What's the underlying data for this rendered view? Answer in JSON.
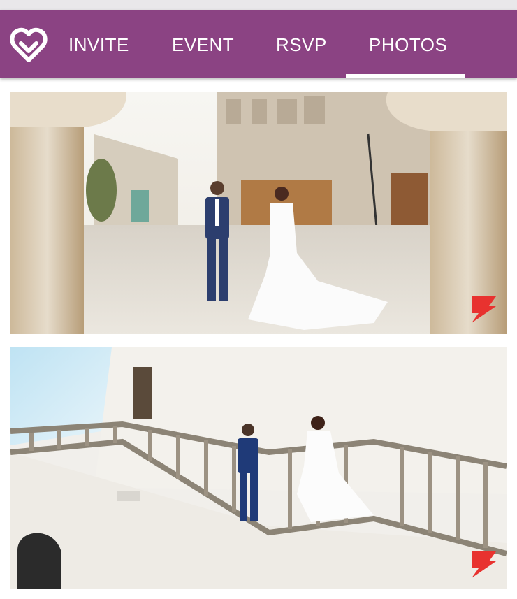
{
  "app": {
    "logo_icon": "heart-location-pin-icon"
  },
  "nav": {
    "tabs": [
      {
        "label": "INVITE",
        "active": false
      },
      {
        "label": "EVENT",
        "active": false
      },
      {
        "label": "RSVP",
        "active": false
      },
      {
        "label": "PHOTOS",
        "active": true
      }
    ]
  },
  "colors": {
    "brand": "#8b4383",
    "nav_text": "#ffffff",
    "watermark": "#e8322f"
  },
  "gallery": {
    "photos": [
      {
        "subject": "couple-holding-hands-courtyard"
      },
      {
        "subject": "couple-on-staircase"
      }
    ]
  }
}
